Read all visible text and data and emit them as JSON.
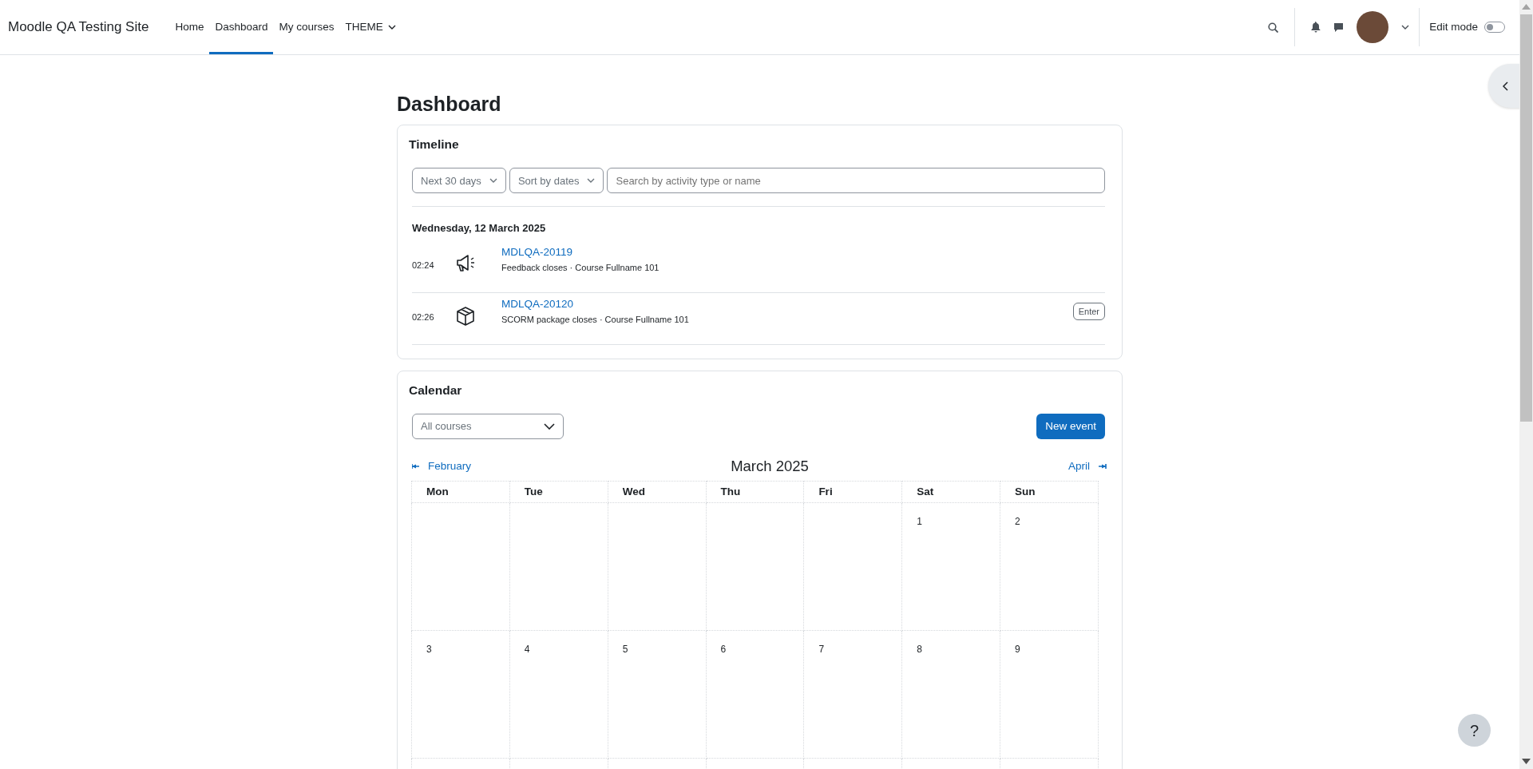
{
  "navbar": {
    "site_name": "Moodle QA Testing Site",
    "links": [
      {
        "label": "Home",
        "selected": false,
        "kind": "link"
      },
      {
        "label": "Dashboard",
        "selected": true,
        "kind": "link"
      },
      {
        "label": "My courses",
        "selected": false,
        "kind": "link"
      },
      {
        "label": "THEME",
        "selected": false,
        "kind": "dropdown"
      }
    ],
    "edit_mode": {
      "label": "Edit mode",
      "on": false
    }
  },
  "page_title": "Dashboard",
  "timeline": {
    "title": "Timeline",
    "filters": [
      {
        "label": "Next 30 days"
      },
      {
        "label": "Sort by dates"
      }
    ],
    "search": {
      "placeholder": "Search by activity type or name"
    },
    "date_heading": "Wednesday, 12 March 2025",
    "events": [
      {
        "time": "02:24",
        "kind": "feedback",
        "name": "MDLQA-20119",
        "detail": "Feedback closes · Course Fullname 101"
      },
      {
        "time": "02:26",
        "kind": "scorm",
        "name": "MDLQA-20120",
        "detail": "SCORM package closes · Course Fullname 101",
        "action": "Enter"
      }
    ]
  },
  "calendar": {
    "title": "Calendar",
    "course_filter": "All courses",
    "new_event": "New event",
    "prev": "February",
    "month": "March 2025",
    "next": "April",
    "weekdays": [
      "Mon",
      "Tue",
      "Wed",
      "Thu",
      "Fri",
      "Sat",
      "Sun"
    ],
    "weeks": [
      [
        "1",
        "2"
      ],
      [
        "3",
        "4",
        "5",
        "6",
        "7",
        "8",
        "9"
      ]
    ]
  },
  "help": {
    "label": "?"
  }
}
